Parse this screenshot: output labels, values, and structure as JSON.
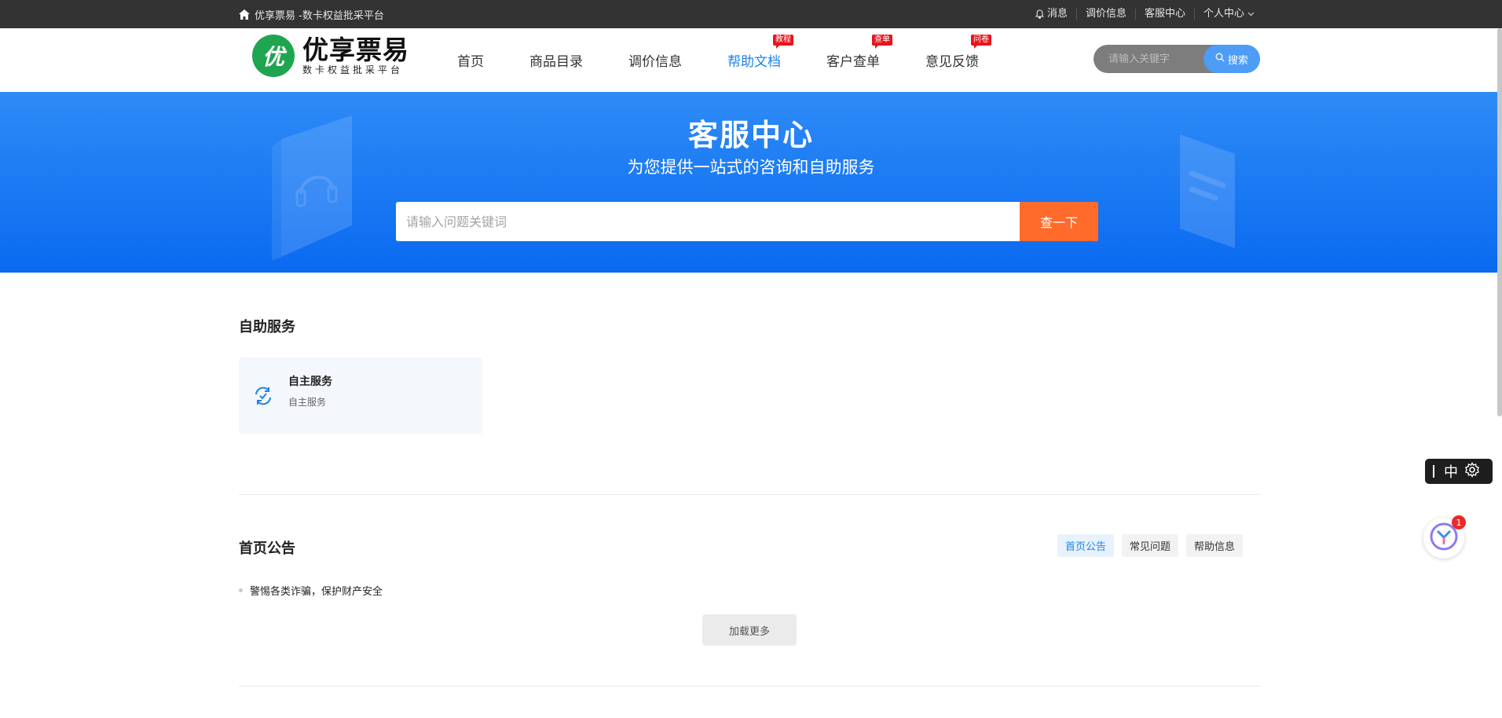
{
  "topbar": {
    "site_title": "优享票易 -数卡权益批采平台",
    "links": [
      {
        "label": "消息",
        "icon": "bell-icon"
      },
      {
        "label": "调价信息"
      },
      {
        "label": "客服中心"
      },
      {
        "label": "个人中心",
        "icon": "chevron-down-icon"
      }
    ]
  },
  "logo": {
    "mark": "优",
    "title": "优享票易",
    "subtitle": "数卡权益批采平台"
  },
  "nav": {
    "items": [
      {
        "label": "首页",
        "badge": ""
      },
      {
        "label": "商品目录",
        "badge": ""
      },
      {
        "label": "调价信息",
        "badge": ""
      },
      {
        "label": "帮助文档",
        "badge": "教程",
        "active": true
      },
      {
        "label": "客户查单",
        "badge": "查单"
      },
      {
        "label": "意见反馈",
        "badge": "问卷"
      }
    ]
  },
  "header_search": {
    "placeholder": "请输入关键字",
    "button_label": "搜索"
  },
  "hero": {
    "title": "客服中心",
    "subtitle": "为您提供一站式的咨询和自助服务",
    "search_placeholder": "请输入问题关键词",
    "search_button": "查一下"
  },
  "self_service": {
    "section_title": "自助服务",
    "cards": [
      {
        "title": "自主服务",
        "description": "自主服务",
        "icon": "refresh-check-icon"
      }
    ]
  },
  "announcements": {
    "section_title": "首页公告",
    "tabs": [
      {
        "label": "首页公告",
        "active": true
      },
      {
        "label": "常见问题"
      },
      {
        "label": "帮助信息"
      }
    ],
    "items": [
      "警惕各类诈骗，保护财产安全"
    ],
    "load_more": "加载更多"
  },
  "widgets": {
    "ime_char": "中",
    "assistant_badge": "1"
  },
  "colors": {
    "topbar_bg": "#333333",
    "accent": "#1c82f0",
    "hero_blue": "#1a7bf4",
    "hero_button": "#fe6b2b",
    "logo_green": "#1fa54f",
    "badge_red": "#e8141b"
  }
}
